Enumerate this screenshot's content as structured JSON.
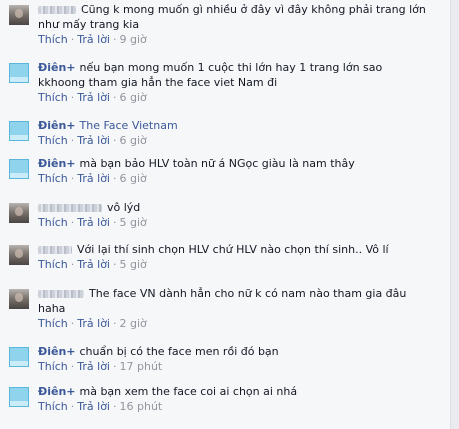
{
  "comments": [
    {
      "author": "",
      "avatar": "person",
      "lines": [
        "Cũng k mong muốn gì nhiều ở đây vì đây không phải trang lớn",
        "như mấy trang kia"
      ],
      "like": "Thích",
      "reply": "Trả lời",
      "time": "9 giờ"
    },
    {
      "author": "Điên+",
      "avatar": "brand",
      "lines": [
        "nếu bạn mong muốn 1 cuộc thi lớn hay 1 trang lớn sao",
        "kkhoong tham gia hẳn the face viet Nam đi"
      ],
      "like": "Thích",
      "reply": "Trả lời",
      "time": "6 giờ"
    },
    {
      "author": "Điên+",
      "avatar": "brand",
      "lines": [
        "The Face Vietnam"
      ],
      "link_text": true,
      "like": "Thích",
      "reply": "Trả lời",
      "time": "6 giờ"
    },
    {
      "author": "Điên+",
      "avatar": "brand",
      "lines": [
        "mà bạn bảo HLV toàn nữ á NGọc giàu là nam thây"
      ],
      "like": "Thích",
      "reply": "Trả lời",
      "time": "6 giờ"
    },
    {
      "author": "",
      "avatar": "person",
      "lines": [
        "vô lýd"
      ],
      "like": "Thích",
      "reply": "Trả lời",
      "time": "5 giờ"
    },
    {
      "author": "",
      "avatar": "person",
      "lines": [
        "Với lại thí sinh chọn HLV chứ HLV nào chọn thí sinh.. Vô lí"
      ],
      "like": "Thích",
      "reply": "Trả lời",
      "time": "5 giờ"
    },
    {
      "author": "",
      "avatar": "person",
      "lines": [
        "The face VN dành hẳn cho nữ k có nam nào tham gia đâu",
        "haha"
      ],
      "like": "Thích",
      "reply": "Trả lời",
      "time": "2 giờ"
    },
    {
      "author": "Điên+",
      "avatar": "brand",
      "lines": [
        "chuẩn bị có the face men rồi đó bạn"
      ],
      "like": "Thích",
      "reply": "Trả lời",
      "time": "17 phút"
    },
    {
      "author": "Điên+",
      "avatar": "brand",
      "lines": [
        "mà bạn xem the face coi ai chọn ai nhá"
      ],
      "like": "Thích",
      "reply": "Trả lời",
      "time": "16 phút"
    }
  ],
  "colors": {
    "link": "#3b5998",
    "muted": "#90949c",
    "background": "#f6f7f9"
  }
}
